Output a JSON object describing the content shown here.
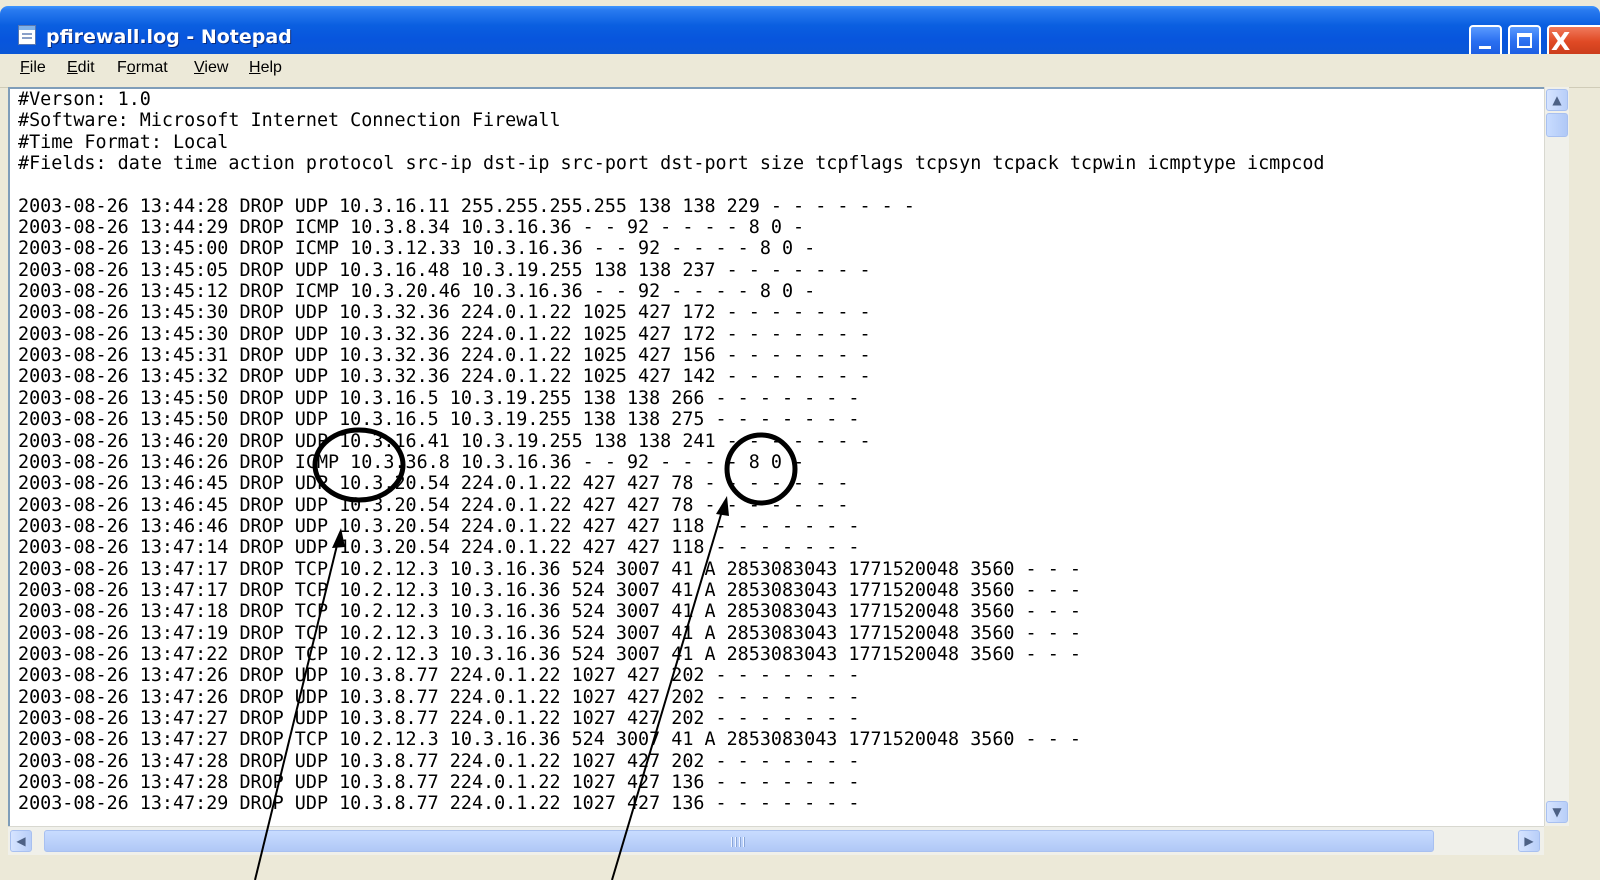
{
  "window": {
    "title": "pfirewall.log - Notepad",
    "close_glyph": "X"
  },
  "menu": {
    "file": {
      "mnemonic": "F",
      "rest": "ile"
    },
    "edit": {
      "mnemonic": "E",
      "rest": "dit"
    },
    "format": {
      "pre": "F",
      "mnemonic": "o",
      "rest": "rmat"
    },
    "view": {
      "mnemonic": "V",
      "rest": "iew"
    },
    "help": {
      "mnemonic": "H",
      "rest": "elp"
    }
  },
  "document": {
    "lines": [
      "#Verson: 1.0",
      "#Software: Microsoft Internet Connection Firewall",
      "#Time Format: Local",
      "#Fields: date time action protocol src-ip dst-ip src-port dst-port size tcpflags tcpsyn tcpack tcpwin icmptype icmpcod",
      "",
      "2003-08-26 13:44:28 DROP UDP 10.3.16.11 255.255.255.255 138 138 229 - - - - - - -",
      "2003-08-26 13:44:29 DROP ICMP 10.3.8.34 10.3.16.36 - - 92 - - - - 8 0 -",
      "2003-08-26 13:45:00 DROP ICMP 10.3.12.33 10.3.16.36 - - 92 - - - - 8 0 -",
      "2003-08-26 13:45:05 DROP UDP 10.3.16.48 10.3.19.255 138 138 237 - - - - - - -",
      "2003-08-26 13:45:12 DROP ICMP 10.3.20.46 10.3.16.36 - - 92 - - - - 8 0 -",
      "2003-08-26 13:45:30 DROP UDP 10.3.32.36 224.0.1.22 1025 427 172 - - - - - - -",
      "2003-08-26 13:45:30 DROP UDP 10.3.32.36 224.0.1.22 1025 427 172 - - - - - - -",
      "2003-08-26 13:45:31 DROP UDP 10.3.32.36 224.0.1.22 1025 427 156 - - - - - - -",
      "2003-08-26 13:45:32 DROP UDP 10.3.32.36 224.0.1.22 1025 427 142 - - - - - - -",
      "2003-08-26 13:45:50 DROP UDP 10.3.16.5 10.3.19.255 138 138 266 - - - - - - -",
      "2003-08-26 13:45:50 DROP UDP 10.3.16.5 10.3.19.255 138 138 275 - - - - - - -",
      "2003-08-26 13:46:20 DROP UDP 10.3.16.41 10.3.19.255 138 138 241 - - - - - - -",
      "2003-08-26 13:46:26 DROP ICMP 10.3.36.8 10.3.16.36 - - 92 - - - - 8 0 -",
      "2003-08-26 13:46:45 DROP UDP 10.3.20.54 224.0.1.22 427 427 78 - - - - - - -",
      "2003-08-26 13:46:45 DROP UDP 10.3.20.54 224.0.1.22 427 427 78 - - - - - - -",
      "2003-08-26 13:46:46 DROP UDP 10.3.20.54 224.0.1.22 427 427 118 - - - - - - -",
      "2003-08-26 13:47:14 DROP UDP 10.3.20.54 224.0.1.22 427 427 118 - - - - - - -",
      "2003-08-26 13:47:17 DROP TCP 10.2.12.3 10.3.16.36 524 3007 41 A 2853083043 1771520048 3560 - - -",
      "2003-08-26 13:47:17 DROP TCP 10.2.12.3 10.3.16.36 524 3007 41 A 2853083043 1771520048 3560 - - -",
      "2003-08-26 13:47:18 DROP TCP 10.2.12.3 10.3.16.36 524 3007 41 A 2853083043 1771520048 3560 - - -",
      "2003-08-26 13:47:19 DROP TCP 10.2.12.3 10.3.16.36 524 3007 41 A 2853083043 1771520048 3560 - - -",
      "2003-08-26 13:47:22 DROP TCP 10.2.12.3 10.3.16.36 524 3007 41 A 2853083043 1771520048 3560 - - -",
      "2003-08-26 13:47:26 DROP UDP 10.3.8.77 224.0.1.22 1027 427 202 - - - - - - -",
      "2003-08-26 13:47:26 DROP UDP 10.3.8.77 224.0.1.22 1027 427 202 - - - - - - -",
      "2003-08-26 13:47:27 DROP UDP 10.3.8.77 224.0.1.22 1027 427 202 - - - - - - -",
      "2003-08-26 13:47:27 DROP TCP 10.2.12.3 10.3.16.36 524 3007 41 A 2853083043 1771520048 3560 - - -",
      "2003-08-26 13:47:28 DROP UDP 10.3.8.77 224.0.1.22 1027 427 202 - - - - - - -",
      "2003-08-26 13:47:28 DROP UDP 10.3.8.77 224.0.1.22 1027 427 136 - - - - - - -",
      "2003-08-26 13:47:29 DROP UDP 10.3.8.77 224.0.1.22 1027 427 136 - - - - - - -"
    ]
  },
  "scrollbars": {
    "up_arrow": "▲",
    "down_arrow": "▼",
    "left_arrow": "◀",
    "right_arrow": "▶"
  }
}
